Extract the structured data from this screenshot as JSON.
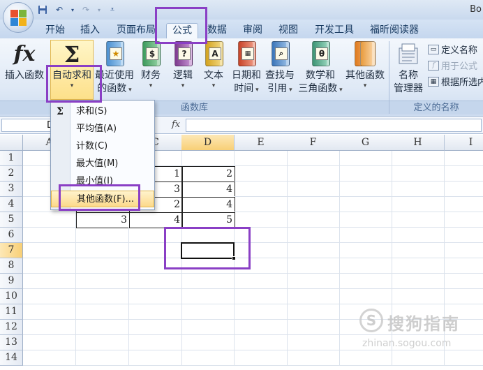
{
  "window": {
    "title": "Bo"
  },
  "tabs": [
    {
      "label": "开始"
    },
    {
      "label": "插入"
    },
    {
      "label": "页面布局"
    },
    {
      "label": "公式"
    },
    {
      "label": "数据"
    },
    {
      "label": "审阅"
    },
    {
      "label": "视图"
    },
    {
      "label": "开发工具"
    },
    {
      "label": "福昕阅读器"
    }
  ],
  "ribbon": {
    "function_library": {
      "group_label": "函数库",
      "buttons": [
        {
          "line1": "插入函数",
          "line2": ""
        },
        {
          "line1": "自动求和",
          "line2": ""
        },
        {
          "line1": "最近使用",
          "line2": "的函数"
        },
        {
          "line1": "财务",
          "line2": ""
        },
        {
          "line1": "逻辑",
          "line2": ""
        },
        {
          "line1": "文本",
          "line2": ""
        },
        {
          "line1": "日期和",
          "line2": "时间"
        },
        {
          "line1": "查找与",
          "line2": "引用"
        },
        {
          "line1": "数学和",
          "line2": "三角函数"
        },
        {
          "line1": "其他函数",
          "line2": ""
        }
      ]
    },
    "defined_names": {
      "group_label": "定义的名称",
      "name_manager": {
        "line1": "名称",
        "line2": "管理器"
      },
      "define_name": "定义名称",
      "use_in_formula": "用于公式",
      "create_from_selection": "根据所选内"
    }
  },
  "formula_bar": {
    "name_box": "D",
    "fx": "fx",
    "formula": ""
  },
  "sheet": {
    "columns": [
      "A",
      "B",
      "C",
      "D",
      "E",
      "F",
      "G",
      "H",
      "I"
    ],
    "rows": [
      "1",
      "2",
      "3",
      "4",
      "5",
      "6",
      "7",
      "8",
      "9",
      "10",
      "11",
      "12",
      "13",
      "14"
    ],
    "cells": {
      "C2": "1",
      "D2": "2",
      "C3": "3",
      "D3": "4",
      "C4": "2",
      "D4": "4",
      "B5": "3",
      "C5": "4",
      "D5": "5"
    },
    "selected_cell": "D7"
  },
  "autosum_menu": {
    "items": [
      {
        "label": "求和(S)",
        "icon": "sigma-icon"
      },
      {
        "label": "平均值(A)"
      },
      {
        "label": "计数(C)"
      },
      {
        "label": "最大值(M)"
      },
      {
        "label": "最小值(I)"
      },
      {
        "label": "其他函数(F)..."
      }
    ]
  },
  "watermark": {
    "text": "搜狗指南",
    "url": "zhinan.sogou.com"
  },
  "colors": {
    "annotation": "#8a3fc5",
    "highlight": "#fcd98a",
    "ribbon": "#dfe9f6"
  }
}
